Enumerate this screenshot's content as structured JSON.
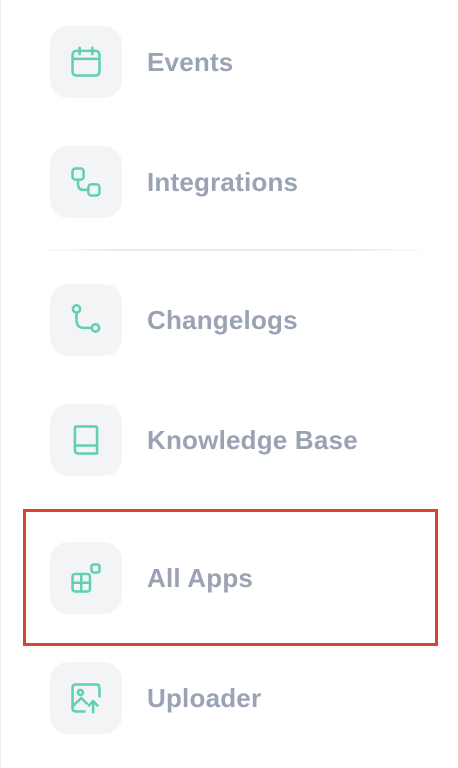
{
  "nav": {
    "items": [
      {
        "label": "Events",
        "icon": "calendar-icon"
      },
      {
        "label": "Integrations",
        "icon": "integrations-icon"
      },
      {
        "label": "Changelogs",
        "icon": "git-branch-icon"
      },
      {
        "label": "Knowledge Base",
        "icon": "book-icon"
      },
      {
        "label": "All Apps",
        "icon": "apps-grid-icon"
      },
      {
        "label": "Uploader",
        "icon": "image-upload-icon"
      }
    ],
    "highlighted_item": "All Apps"
  },
  "colors": {
    "icon_accent": "#5fd0b0",
    "label_text": "#9aa3b4",
    "icon_background": "#f3f4f6",
    "highlight_border": "#d9442e"
  }
}
